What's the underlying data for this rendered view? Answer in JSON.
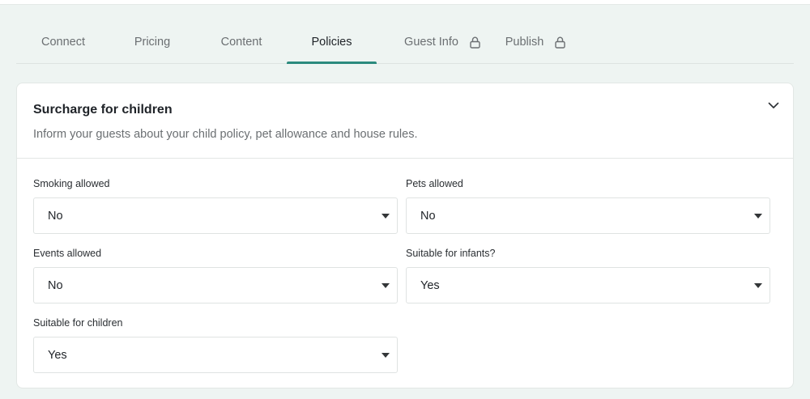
{
  "tabs": [
    {
      "label": "Connect",
      "locked": false
    },
    {
      "label": "Pricing",
      "locked": false
    },
    {
      "label": "Content",
      "locked": false
    },
    {
      "label": "Policies",
      "locked": false,
      "active": true
    },
    {
      "label": "Guest Info",
      "locked": true
    },
    {
      "label": "Publish",
      "locked": true
    }
  ],
  "card": {
    "title": "Surcharge for children",
    "description": "Inform your guests about your child policy, pet allowance and house rules."
  },
  "fields": {
    "smoking": {
      "label": "Smoking allowed",
      "value": "No"
    },
    "pets": {
      "label": "Pets allowed",
      "value": "No"
    },
    "events": {
      "label": "Events allowed",
      "value": "No"
    },
    "infants": {
      "label": "Suitable for infants?",
      "value": "Yes"
    },
    "children": {
      "label": "Suitable for children",
      "value": "Yes"
    }
  },
  "colors": {
    "accent": "#2b8a7e",
    "background": "#eef4f2"
  },
  "icons": {
    "lock": "lock-icon",
    "collapse": "chevron-down-icon",
    "dropdown": "caret-down-icon"
  }
}
